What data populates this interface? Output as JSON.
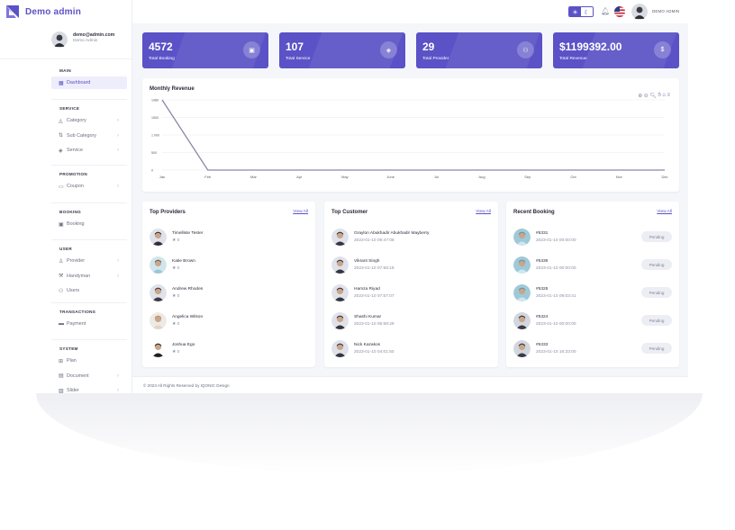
{
  "brand": {
    "name": "Demo admin",
    "accent": "#5a52c6"
  },
  "user": {
    "email": "demo@admin.com",
    "role": "Demo Admin"
  },
  "header": {
    "user_name": "DEMO ADMIN",
    "theme_light_icon": "sun-icon",
    "theme_dark_icon": "moon-icon"
  },
  "sidebar": {
    "sections": [
      {
        "label": "MAIN",
        "items": [
          {
            "label": "Dashboard",
            "icon": "grid-icon",
            "active": true
          }
        ]
      },
      {
        "label": "SERVICE",
        "items": [
          {
            "label": "Category",
            "icon": "shapes-icon",
            "chevron": true
          },
          {
            "label": "Sub Category",
            "icon": "subcategory-icon",
            "chevron": true
          },
          {
            "label": "Service",
            "icon": "service-icon",
            "chevron": true
          }
        ]
      },
      {
        "label": "PROMOTION",
        "items": [
          {
            "label": "Coupon",
            "icon": "coupon-icon",
            "chevron": true
          }
        ]
      },
      {
        "label": "BOOKING",
        "items": [
          {
            "label": "Booking",
            "icon": "calendar-icon"
          }
        ]
      },
      {
        "label": "USER",
        "items": [
          {
            "label": "Provider",
            "icon": "provider-icon",
            "chevron": true
          },
          {
            "label": "Handyman",
            "icon": "handyman-icon",
            "chevron": true
          },
          {
            "label": "Users",
            "icon": "users-icon"
          }
        ]
      },
      {
        "label": "TRANSACTIONS",
        "items": [
          {
            "label": "Payment",
            "icon": "card-icon"
          }
        ]
      },
      {
        "label": "SYSTEM",
        "items": [
          {
            "label": "Plan",
            "icon": "plan-icon"
          },
          {
            "label": "Document",
            "icon": "document-icon",
            "chevron": true
          },
          {
            "label": "Slider",
            "icon": "image-icon",
            "chevron": true
          }
        ]
      }
    ]
  },
  "stats": [
    {
      "value": "4572",
      "label": "Total Booking",
      "icon": "calendar-icon"
    },
    {
      "value": "107",
      "label": "Total Service",
      "icon": "service-icon"
    },
    {
      "value": "29",
      "label": "Total Provider",
      "icon": "users-icon"
    },
    {
      "value": "$1199392.00",
      "label": "Total Revenue",
      "icon": "dollar-icon"
    }
  ],
  "revenue": {
    "title": "Monthly Revenue",
    "tools": [
      "zoom-in-icon",
      "zoom-out-icon",
      "search-icon",
      "pan-icon",
      "home-icon",
      "menu-icon"
    ]
  },
  "chart_data": {
    "type": "line",
    "title": "Monthly Revenue",
    "categories": [
      "Jan",
      "Feb",
      "Mar",
      "Apr",
      "May",
      "June",
      "Jul",
      "Aug",
      "Sep",
      "Oct",
      "Nov",
      "Dec"
    ],
    "values": [
      1480,
      0,
      0,
      0,
      0,
      0,
      0,
      0,
      0,
      0,
      0,
      0
    ],
    "yticks": [
      "0",
      "500",
      "1 000",
      "1500",
      "1480"
    ],
    "ytick_values": [
      0,
      370,
      740,
      1110,
      1480
    ],
    "ylim": [
      0,
      1480
    ],
    "grid": true,
    "line_color": "#8a87a8"
  },
  "providers": {
    "title": "Top Providers",
    "view_all": "View All",
    "rows": [
      {
        "name": "Timelliste Tester",
        "rating": "★ 0"
      },
      {
        "name": "Katie Brown",
        "rating": "★ 0"
      },
      {
        "name": "Andrew Rhodes",
        "rating": "★ 0"
      },
      {
        "name": "Angelica Wilson",
        "rating": "★ 0"
      },
      {
        "name": "Joshua Ego",
        "rating": "★ 0"
      }
    ]
  },
  "customers": {
    "title": "Top Customer",
    "view_all": "View All",
    "rows": [
      {
        "name": "Graylon Abukhadir Abukhadir Mayberry",
        "date": "2023-01-10 09:47:08"
      },
      {
        "name": "Vikrant Singh",
        "date": "2023-01-10 07:58:18"
      },
      {
        "name": "Hamza Riyad",
        "date": "2023-01-10 07:57:07"
      },
      {
        "name": "Shashi Kumar",
        "date": "2023-01-10 05:58:29"
      },
      {
        "name": "Nick Kazakos",
        "date": "2023-01-10 04:01:50"
      }
    ]
  },
  "bookings": {
    "title": "Recent Booking",
    "view_all": "View All",
    "rows": [
      {
        "id": "#5331",
        "date": "2023-01-10 00:00:00",
        "status": "Pending"
      },
      {
        "id": "#5336",
        "date": "2023-01-10 00:00:00",
        "status": "Pending"
      },
      {
        "id": "#5325",
        "date": "2023-01-10 09:03:41",
        "status": "Pending"
      },
      {
        "id": "#5324",
        "date": "2023-01-10 00:00:00",
        "status": "Pending"
      },
      {
        "id": "#5333",
        "date": "2023-01-10 16:33:00",
        "status": "Pending"
      }
    ]
  },
  "footer": {
    "text": "© 2023 All Rights Reserved by IQONIC Design"
  }
}
